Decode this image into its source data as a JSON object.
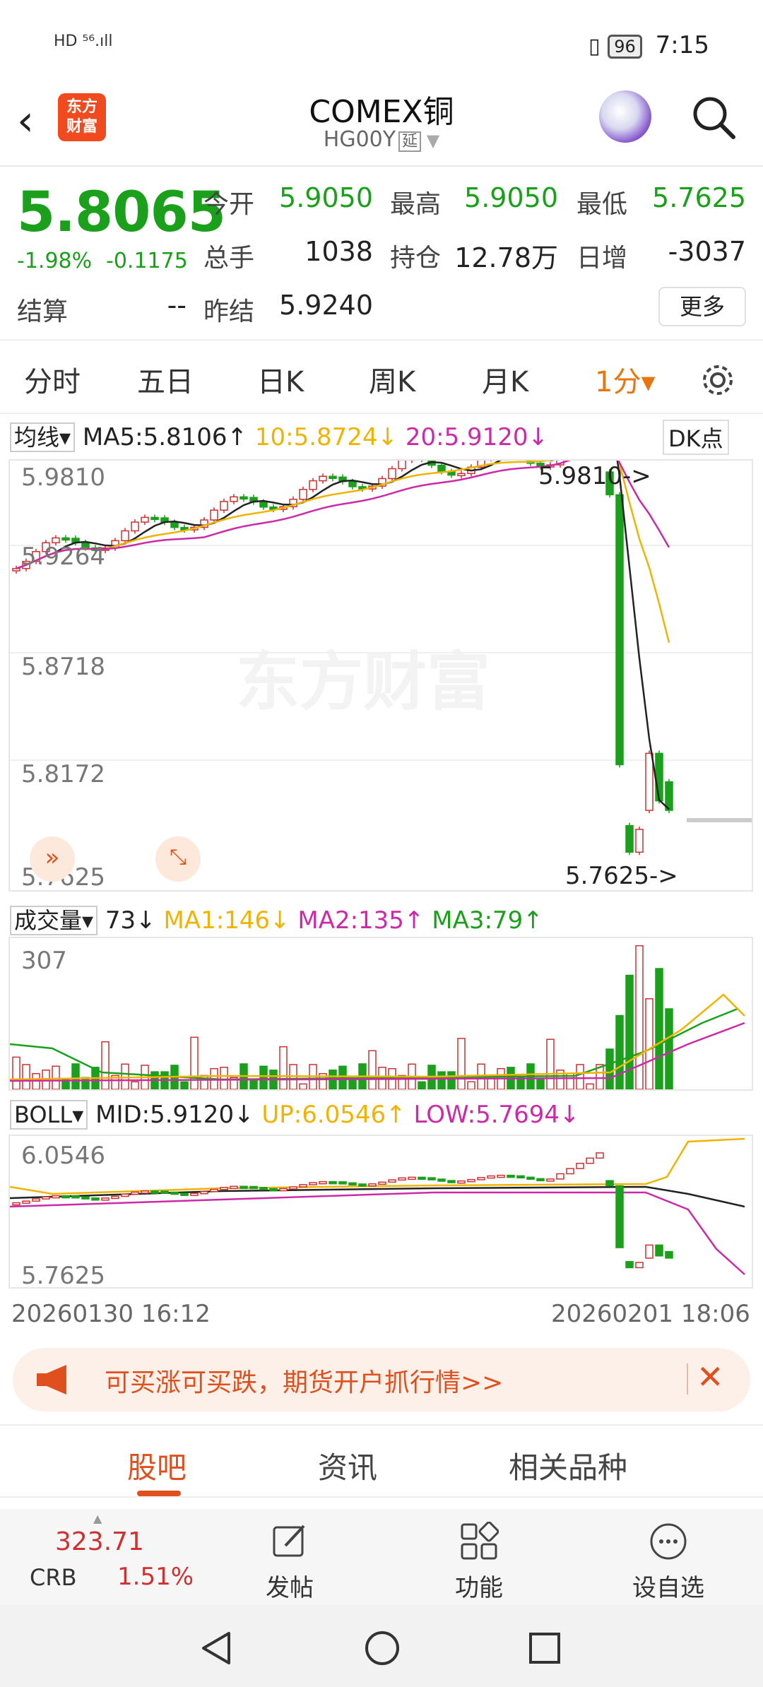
{
  "status_bar": {
    "left": "HD ⁵⁶.ıll",
    "battery": "96",
    "time": "7:15"
  },
  "header": {
    "title": "COMEX铜",
    "subtitle": "HG00Y",
    "delay_tag": "延",
    "logo_text": "东方财富"
  },
  "quote": {
    "price": "5.8065",
    "change_pct": "-1.98%",
    "change": "-0.1175",
    "open_label": "今开",
    "open": "5.9050",
    "high_label": "最高",
    "high": "5.9050",
    "low_label": "最低",
    "low": "5.7625",
    "volume_label": "总手",
    "volume": "1038",
    "oi_label": "持仓",
    "oi": "12.78万",
    "daily_inc_label": "日增",
    "daily_inc": "-3037",
    "settle_label": "结算",
    "settle": "--",
    "prev_settle_label": "昨结",
    "prev_settle": "5.9240",
    "more_label": "更多"
  },
  "period_tabs": [
    "分时",
    "五日",
    "日K",
    "周K",
    "月K",
    "1分▾"
  ],
  "ma_bar": {
    "select": "均线▾",
    "ma5": "MA5:5.8106↑",
    "ma10": "10:5.8724↓",
    "ma20": "20:5.9120↓",
    "dk": "DK点"
  },
  "main_chart": {
    "y_labels": [
      "5.9810",
      "5.9264",
      "5.8718",
      "5.8172",
      "5.7625"
    ],
    "max_marker": "5.9810->",
    "min_marker": "5.7625->",
    "watermark": "东方财富"
  },
  "vol_bar": {
    "select": "成交量▾",
    "val": "73↓",
    "ma1": "MA1:146↓",
    "ma2": "MA2:135↑",
    "ma3": "MA3:79↑",
    "ymax": "307"
  },
  "boll_bar": {
    "select": "BOLL▾",
    "mid": "MID:5.9120↓",
    "up": "UP:6.0546↑",
    "low": "LOW:5.7694↓",
    "ytop": "6.0546",
    "ybot": "5.7625"
  },
  "time_axis": {
    "start": "20260130 16:12",
    "end": "20260201 18:06"
  },
  "banner": {
    "text": "可买涨可买跌，期货开户抓行情>>",
    "close": "✕"
  },
  "bottom_tabs": [
    "股吧",
    "资讯",
    "相关品种"
  ],
  "toolbar": {
    "index_value": "323.71",
    "index_name": "CRB",
    "index_pct": "1.51%",
    "post": "发帖",
    "func": "功能",
    "watch": "设自选"
  },
  "colors": {
    "up": "#d03030",
    "down": "#1aa01a",
    "ma10": "#f0b400",
    "ma20": "#cc2aa8",
    "accent": "#e8760c"
  }
}
